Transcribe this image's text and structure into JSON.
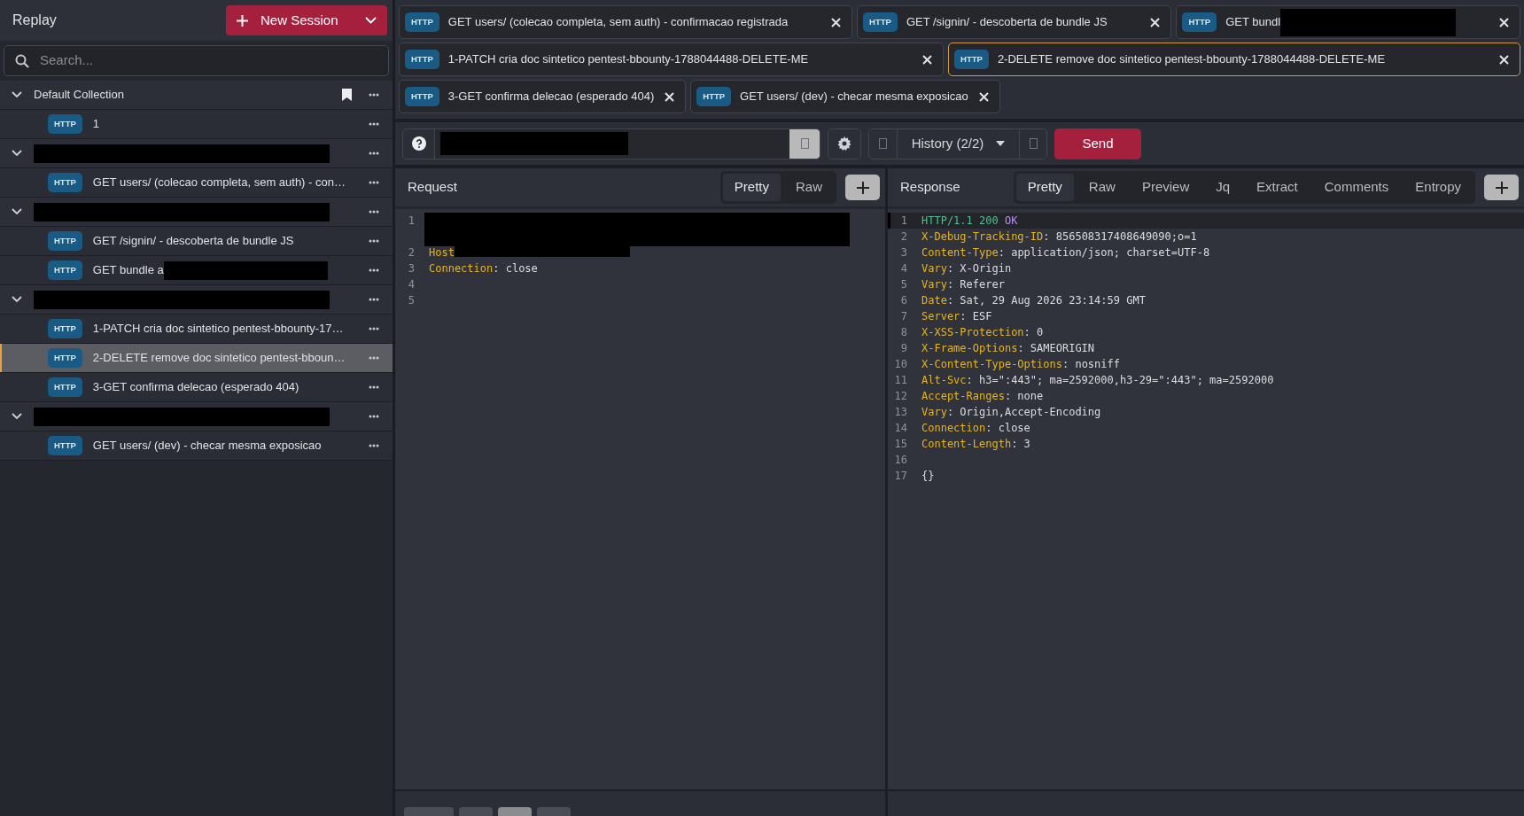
{
  "sidebar": {
    "title": "Replay",
    "new_session_button": "New Session",
    "search": {
      "placeholder": "Search..."
    },
    "collections": [
      {
        "name": "Default Collection",
        "redacted": false,
        "bookmarked": true,
        "expanded": true,
        "sessions": [
          {
            "badge": "HTTP",
            "label": "1",
            "redacted_tail": false,
            "selected": false
          }
        ]
      },
      {
        "redacted": true,
        "bookmarked": false,
        "expanded": true,
        "sessions": [
          {
            "badge": "HTTP",
            "label": "GET users/ (colecao completa, sem auth) - con…",
            "redacted_tail": false,
            "selected": false
          }
        ]
      },
      {
        "redacted": true,
        "bookmarked": false,
        "expanded": true,
        "sessions": [
          {
            "badge": "HTTP",
            "label": "GET /signin/ - descoberta de bundle JS",
            "redacted_tail": false,
            "selected": false
          },
          {
            "badge": "HTTP",
            "label": "GET bundle a",
            "redacted_tail": true,
            "selected": false
          }
        ]
      },
      {
        "redacted": true,
        "bookmarked": false,
        "expanded": true,
        "sessions": [
          {
            "badge": "HTTP",
            "label": "1-PATCH cria doc sintetico pentest-bbounty-17…",
            "redacted_tail": false,
            "selected": false
          },
          {
            "badge": "HTTP",
            "label": "2-DELETE remove doc sintetico pentest-bboun…",
            "redacted_tail": false,
            "selected": true
          },
          {
            "badge": "HTTP",
            "label": "3-GET confirma delecao (esperado 404)",
            "redacted_tail": false,
            "selected": false
          }
        ]
      },
      {
        "redacted": true,
        "bookmarked": false,
        "expanded": true,
        "sessions": [
          {
            "badge": "HTTP",
            "label": "GET users/ (dev) - checar mesma exposicao",
            "redacted_tail": false,
            "selected": false
          }
        ]
      }
    ]
  },
  "tab_rows": [
    [
      {
        "badge": "HTTP",
        "label": "GET users/ (colecao completa, sem auth) - confirmacao registrada",
        "redacted_tail": false,
        "selected": false
      },
      {
        "badge": "HTTP",
        "label": "GET /signin/ - descoberta de bundle JS",
        "redacted_tail": false,
        "selected": false
      },
      {
        "badge": "HTTP",
        "label": "GET bundl",
        "redacted_tail": true,
        "selected": false
      }
    ],
    [
      {
        "badge": "HTTP",
        "label": "1-PATCH cria doc sintetico pentest-bbounty-1788044488-DELETE-ME",
        "redacted_tail": false,
        "selected": false
      },
      {
        "badge": "HTTP",
        "label": "2-DELETE remove doc sintetico pentest-bbounty-1788044488-DELETE-ME",
        "redacted_tail": false,
        "selected": true
      }
    ],
    [
      {
        "badge": "HTTP",
        "label": "3-GET confirma delecao (esperado 404)",
        "redacted_tail": false,
        "selected": false
      },
      {
        "badge": "HTTP",
        "label": "GET users/ (dev) - checar mesma exposicao",
        "redacted_tail": false,
        "selected": false
      }
    ]
  ],
  "toolbar": {
    "url_redacted": true,
    "history": "History (2/2)",
    "send_button": "Send"
  },
  "request": {
    "title": "Request",
    "views": [
      {
        "label": "Pretty",
        "selected": true
      },
      {
        "label": "Raw",
        "selected": false
      }
    ],
    "lines": [
      {
        "number": "1",
        "parts": [
          {
            "kind": "redacted"
          }
        ]
      },
      {
        "number": "2",
        "parts": [
          {
            "kind": "key",
            "text": "Host"
          },
          {
            "kind": "redacted"
          }
        ]
      },
      {
        "number": "3",
        "parts": [
          {
            "kind": "key",
            "text": "Connection"
          },
          {
            "kind": "plain",
            "text": ": close"
          }
        ]
      },
      {
        "number": "4"
      },
      {
        "number": "5"
      }
    ]
  },
  "response": {
    "title": "Response",
    "views": [
      {
        "label": "Pretty",
        "selected": true
      },
      {
        "label": "Raw",
        "selected": false
      },
      {
        "label": "Preview",
        "selected": false
      },
      {
        "label": "Jq",
        "selected": false
      },
      {
        "label": "Extract",
        "selected": false
      },
      {
        "label": "Comments",
        "selected": false
      },
      {
        "label": "Entropy",
        "selected": false
      }
    ],
    "lines": [
      {
        "number": "1",
        "current": true,
        "parts": [
          {
            "kind": "status",
            "text": "HTTP/1.1 200"
          },
          {
            "kind": "reason",
            "text": " OK"
          }
        ]
      },
      {
        "number": "2",
        "current": false,
        "parts": [
          {
            "kind": "key",
            "text": "X-Debug-Tracking-ID"
          },
          {
            "kind": "plain",
            "text": ": 856508317408649090;o=1"
          }
        ]
      },
      {
        "number": "3",
        "current": false,
        "parts": [
          {
            "kind": "key",
            "text": "Content-Type"
          },
          {
            "kind": "plain",
            "text": ": application/json; charset=UTF-8"
          }
        ]
      },
      {
        "number": "4",
        "current": false,
        "parts": [
          {
            "kind": "key",
            "text": "Vary"
          },
          {
            "kind": "plain",
            "text": ": X-Origin"
          }
        ]
      },
      {
        "number": "5",
        "current": false,
        "parts": [
          {
            "kind": "key",
            "text": "Vary"
          },
          {
            "kind": "plain",
            "text": ": Referer"
          }
        ]
      },
      {
        "number": "6",
        "current": false,
        "parts": [
          {
            "kind": "key",
            "text": "Date"
          },
          {
            "kind": "plain",
            "text": ": Sat, 29 Aug 2026 23:14:59 GMT"
          }
        ]
      },
      {
        "number": "7",
        "current": false,
        "parts": [
          {
            "kind": "key",
            "text": "Server"
          },
          {
            "kind": "plain",
            "text": ": ESF"
          }
        ]
      },
      {
        "number": "8",
        "current": false,
        "parts": [
          {
            "kind": "key",
            "text": "X-XSS-Protection"
          },
          {
            "kind": "plain",
            "text": ": 0"
          }
        ]
      },
      {
        "number": "9",
        "current": false,
        "parts": [
          {
            "kind": "key",
            "text": "X-Frame-Options"
          },
          {
            "kind": "plain",
            "text": ": SAMEORIGIN"
          }
        ]
      },
      {
        "number": "10",
        "current": false,
        "parts": [
          {
            "kind": "key",
            "text": "X-Content-Type-Options"
          },
          {
            "kind": "plain",
            "text": ": nosniff"
          }
        ]
      },
      {
        "number": "11",
        "current": false,
        "parts": [
          {
            "kind": "key",
            "text": "Alt-Svc"
          },
          {
            "kind": "plain",
            "text": ": h3=\":443\"; ma=2592000,h3-29=\":443\"; ma=2592000"
          }
        ]
      },
      {
        "number": "12",
        "current": false,
        "parts": [
          {
            "kind": "key",
            "text": "Accept-Ranges"
          },
          {
            "kind": "plain",
            "text": ": none"
          }
        ]
      },
      {
        "number": "13",
        "current": false,
        "parts": [
          {
            "kind": "key",
            "text": "Vary"
          },
          {
            "kind": "plain",
            "text": ": Origin,Accept-Encoding"
          }
        ]
      },
      {
        "number": "14",
        "current": false,
        "parts": [
          {
            "kind": "key",
            "text": "Connection"
          },
          {
            "kind": "plain",
            "text": ": close"
          }
        ]
      },
      {
        "number": "15",
        "current": false,
        "parts": [
          {
            "kind": "key",
            "text": "Content-Length"
          },
          {
            "kind": "plain",
            "text": ": 3"
          }
        ]
      },
      {
        "number": "16",
        "current": false
      },
      {
        "number": "17",
        "current": false,
        "parts": [
          {
            "kind": "plain",
            "text": "{}"
          }
        ]
      }
    ]
  }
}
